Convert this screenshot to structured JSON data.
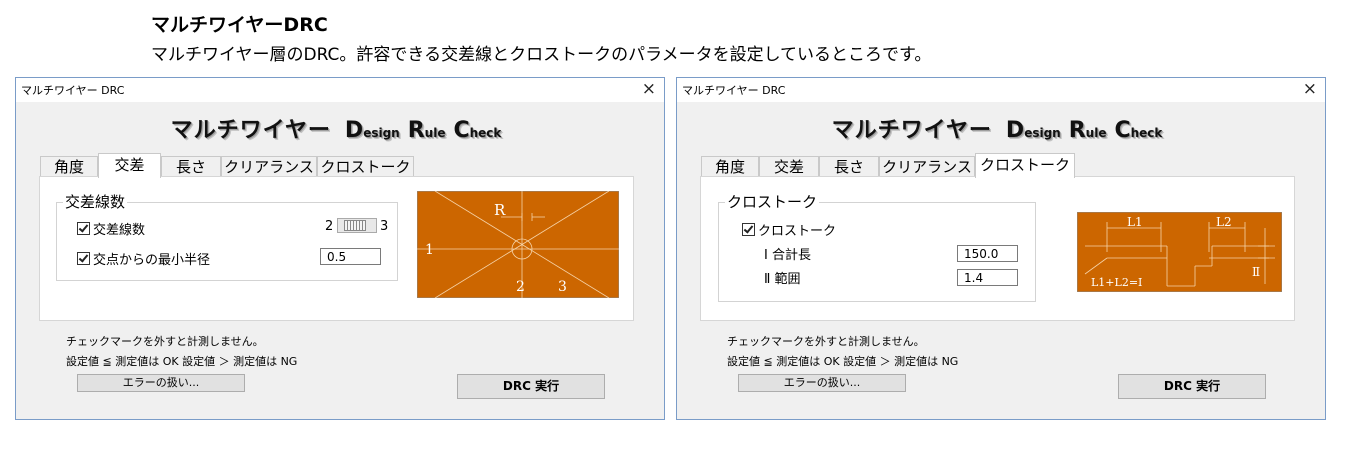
{
  "heading": "マルチワイヤーDRC",
  "subheading": "マルチワイヤー層のDRC。許容できる交差線とクロストークのパラメータを設定しているところです。",
  "colors": {
    "diagram_bg": "#cc6600",
    "diagram_line": "#f6d3a8",
    "window_border": "#7a9cc8"
  },
  "windows": [
    {
      "title": "マルチワイヤー DRC",
      "close_icon": "×",
      "logo": {
        "main": "マルチワイヤー",
        "d": "D",
        "d_rest": "esign",
        "r": "R",
        "r_rest": "ule",
        "c": "C",
        "c_rest": "heck"
      },
      "tabs": [
        {
          "label": "角度",
          "active": false
        },
        {
          "label": "交差",
          "active": true
        },
        {
          "label": "長さ",
          "active": false
        },
        {
          "label": "クリアランス",
          "active": false
        },
        {
          "label": "クロストーク",
          "active": false
        }
      ],
      "group_title": "交差線数",
      "check1": {
        "label": "交差線数",
        "checked": true
      },
      "slider": {
        "min_label": "2",
        "max_label": "3"
      },
      "check2": {
        "label": "交点からの最小半径",
        "checked": true
      },
      "radius_value": "0.5",
      "diagram_labels": {
        "r": "R",
        "n1": "1",
        "n2": "2",
        "n3": "3"
      },
      "note1": "チェックマークを外すと計測しません。",
      "note2": "設定値 ≦ 測定値は OK 設定値 ＞ 測定値は NG",
      "error_button": "エラーの扱い...",
      "run_button": "DRC 実行"
    },
    {
      "title": "マルチワイヤー DRC",
      "close_icon": "×",
      "logo": {
        "main": "マルチワイヤー",
        "d": "D",
        "d_rest": "esign",
        "r": "R",
        "r_rest": "ule",
        "c": "C",
        "c_rest": "heck"
      },
      "tabs": [
        {
          "label": "角度",
          "active": false
        },
        {
          "label": "交差",
          "active": false
        },
        {
          "label": "長さ",
          "active": false
        },
        {
          "label": "クリアランス",
          "active": false
        },
        {
          "label": "クロストーク",
          "active": true
        }
      ],
      "group_title": "クロストーク",
      "check1": {
        "label": "クロストーク",
        "checked": true
      },
      "field1": {
        "label": "Ⅰ 合計長",
        "value": "150.0"
      },
      "field2": {
        "label": "Ⅱ 範囲",
        "value": "1.4"
      },
      "diagram_labels": {
        "l1": "L1",
        "l2": "L2",
        "ii": "Ⅱ",
        "formula": "L1+L2=Ⅰ"
      },
      "note1": "チェックマークを外すと計測しません。",
      "note2": "設定値 ≦ 測定値は OK 設定値 ＞ 測定値は NG",
      "error_button": "エラーの扱い...",
      "run_button": "DRC 実行"
    }
  ]
}
